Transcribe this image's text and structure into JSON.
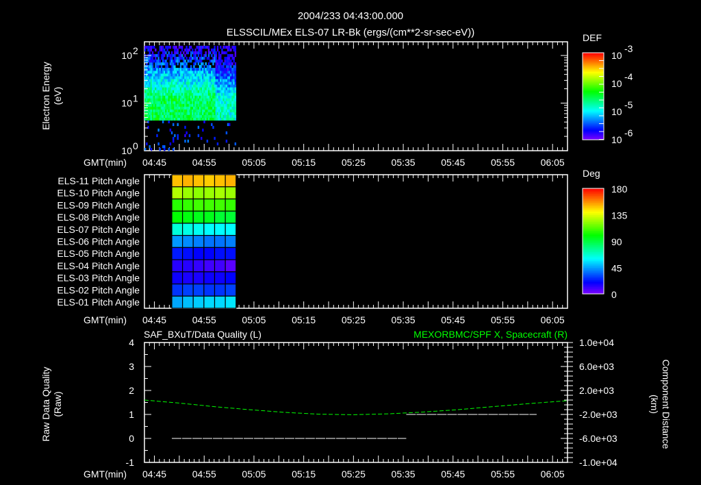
{
  "header": {
    "title": "2004/233 04:43:00.000",
    "subtitle": "ELSSCIL/MEx ELS-07 LR-Bk  (ergs/(cm**2-sr-sec-eV))"
  },
  "colors": {
    "background": "#000000",
    "axis": "#ffffff",
    "orbit_line": "#00ff00",
    "quality_line": "#ffffff"
  },
  "chart_data": [
    {
      "type": "heatmap",
      "name": "electron-energy-spectrogram",
      "ylabel": [
        "Electron Energy",
        "(eV)"
      ],
      "xlabel": "GMT(min)",
      "x_ticks": [
        "04:45",
        "04:55",
        "05:05",
        "05:15",
        "05:25",
        "05:35",
        "05:45",
        "05:55",
        "06:05"
      ],
      "x_range_min": [
        283,
        368
      ],
      "y_scale": "log",
      "y_range": [
        1,
        195
      ],
      "y_ticks": [
        {
          "base": "10",
          "exp": "0",
          "value": 1
        },
        {
          "base": "10",
          "exp": "1",
          "value": 10
        },
        {
          "base": "10",
          "exp": "2",
          "value": 100
        }
      ],
      "data_time_range_min": [
        283,
        301.4
      ],
      "data_energy_range_ev": [
        1,
        140
      ],
      "dense_band_ev": [
        4,
        50
      ],
      "peak_log_def": -4.3,
      "colorbar": {
        "label": "DEF",
        "log_range": [
          -6.1,
          -3
        ],
        "ticks": [
          {
            "base": "10",
            "exp": "-3",
            "value": -3
          },
          {
            "base": "10",
            "exp": "-4",
            "value": -4
          },
          {
            "base": "10",
            "exp": "-5",
            "value": -5
          },
          {
            "base": "10",
            "exp": "-6",
            "value": -6
          }
        ]
      }
    },
    {
      "type": "heatmap",
      "name": "pitch-angle-grid",
      "xlabel": "GMT(min)",
      "x_ticks": [
        "04:45",
        "04:55",
        "05:05",
        "05:15",
        "05:25",
        "05:35",
        "05:45",
        "05:55",
        "06:05"
      ],
      "data_time_range_min": [
        288.5,
        301.4
      ],
      "rows": [
        {
          "label": "ELS-11 Pitch Angle",
          "values": [
            150,
            152,
            150,
            148,
            150,
            152
          ]
        },
        {
          "label": "ELS-10 Pitch Angle",
          "values": [
            128,
            124,
            122,
            124,
            126,
            124
          ]
        },
        {
          "label": "ELS-09 Pitch Angle",
          "values": [
            106,
            108,
            110,
            110,
            110,
            108
          ]
        },
        {
          "label": "ELS-08 Pitch Angle",
          "values": [
            100,
            98,
            96,
            96,
            92,
            92
          ]
        },
        {
          "label": "ELS-07 Pitch Angle",
          "values": [
            66,
            64,
            62,
            60,
            60,
            60
          ]
        },
        {
          "label": "ELS-06 Pitch Angle",
          "values": [
            44,
            42,
            40,
            38,
            38,
            40
          ]
        },
        {
          "label": "ELS-05 Pitch Angle",
          "values": [
            24,
            22,
            20,
            20,
            22,
            22
          ]
        },
        {
          "label": "ELS-04 Pitch Angle",
          "values": [
            14,
            14,
            12,
            10,
            10,
            6
          ]
        },
        {
          "label": "ELS-03 Pitch Angle",
          "values": [
            18,
            16,
            16,
            18,
            18,
            20
          ]
        },
        {
          "label": "ELS-02 Pitch Angle",
          "values": [
            28,
            30,
            30,
            28,
            28,
            30
          ]
        },
        {
          "label": "ELS-01 Pitch Angle",
          "values": [
            46,
            50,
            52,
            54,
            54,
            56
          ]
        }
      ],
      "colorbar": {
        "label": "Deg",
        "range": [
          0,
          180
        ],
        "ticks": [
          "180",
          "135",
          "90",
          "45",
          "0"
        ]
      }
    },
    {
      "type": "line",
      "name": "quality-and-orbit",
      "left_title": "SAF_BXuT/Data Quality (L)",
      "right_title": "MEXORBMC/SPF X, Spacecraft (R)",
      "ylabel_left": [
        "Raw Data Quality",
        "(Raw)"
      ],
      "ylabel_right": [
        "Component Distance",
        "(km)"
      ],
      "xlabel": "GMT(min)",
      "x_ticks": [
        "04:45",
        "04:55",
        "05:05",
        "05:15",
        "05:25",
        "05:35",
        "05:45",
        "05:55",
        "06:05"
      ],
      "y_left_range": [
        -1,
        4
      ],
      "y_left_ticks": [
        "4",
        "3",
        "2",
        "1",
        "0",
        "-1"
      ],
      "y_right_range": [
        -10000,
        10000
      ],
      "y_right_ticks": [
        "1.0e+04",
        "6.0e+03",
        "2.0e+03",
        "-2.0e+03",
        "-6.0e+03",
        "-1.0e+04"
      ],
      "series": [
        {
          "name": "Data Quality",
          "axis": "left",
          "segments": [
            {
              "t": [
                288.5,
                335.6
              ],
              "value": 0
            },
            {
              "t": [
                335.6,
                361.8
              ],
              "value": 1
            }
          ]
        },
        {
          "name": "SPF X Spacecraft",
          "axis": "right",
          "t": [
            283,
            290,
            297,
            304,
            311,
            318,
            325,
            332,
            339,
            346,
            353,
            360,
            368
          ],
          "values": [
            400,
            -100,
            -700,
            -1200,
            -1650,
            -1950,
            -2050,
            -1900,
            -1600,
            -1200,
            -700,
            -200,
            300
          ]
        }
      ]
    }
  ]
}
